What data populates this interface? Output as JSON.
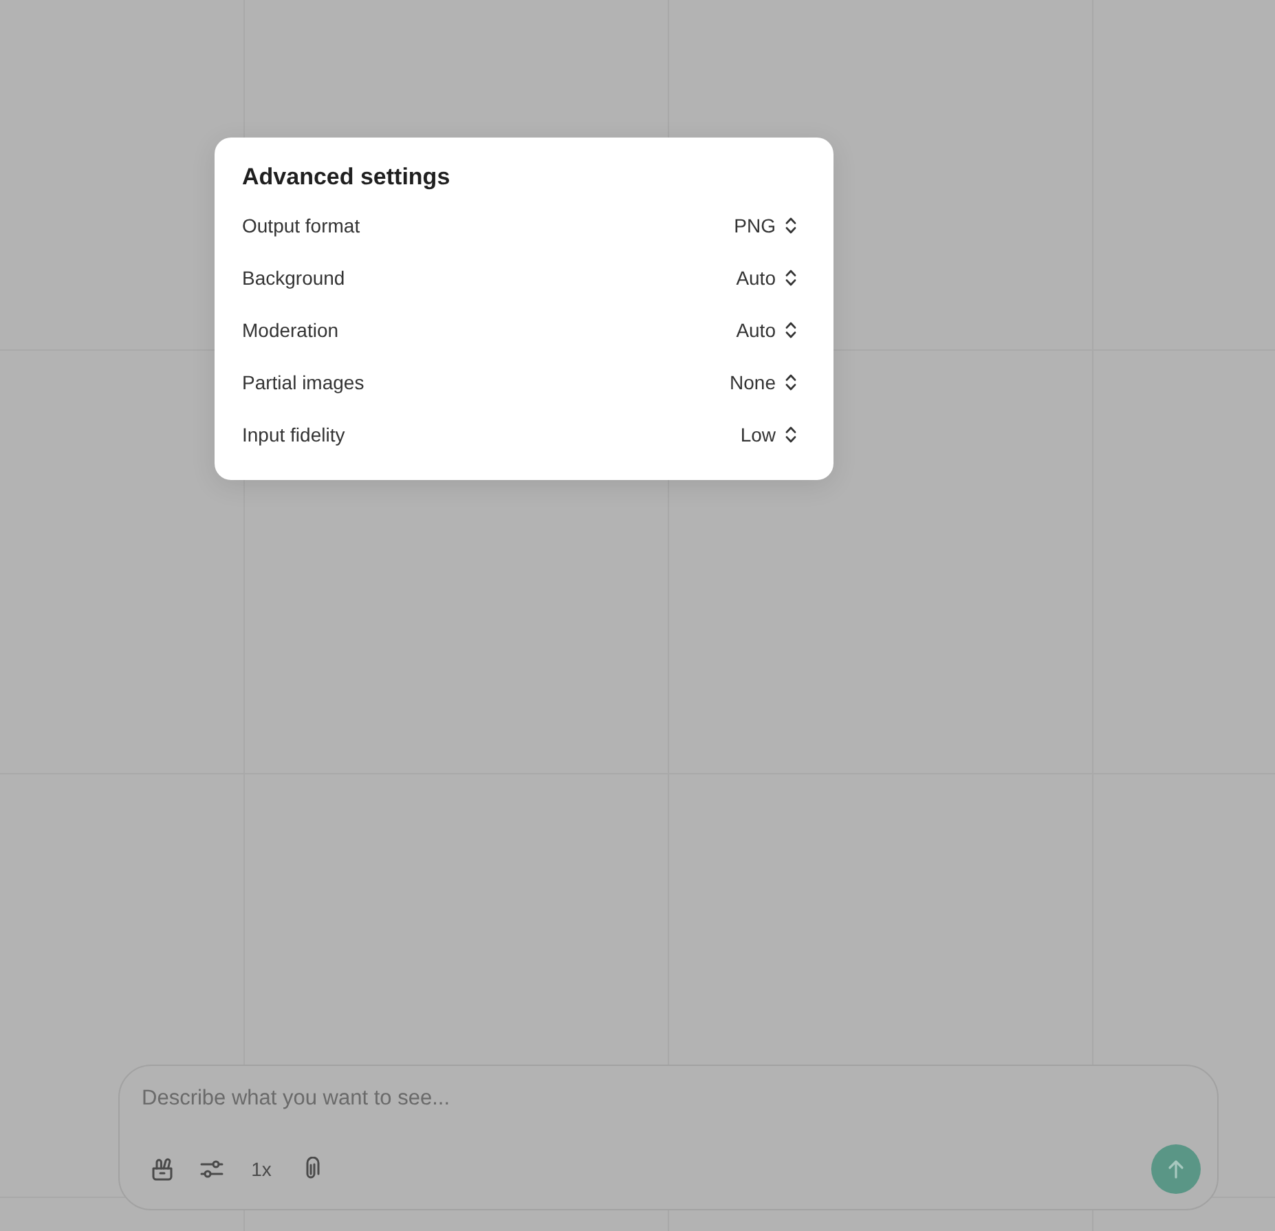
{
  "dialog": {
    "title": "Advanced settings",
    "settings": [
      {
        "label": "Output format",
        "value": "PNG"
      },
      {
        "label": "Background",
        "value": "Auto"
      },
      {
        "label": "Moderation",
        "value": "Auto"
      },
      {
        "label": "Partial images",
        "value": "None"
      },
      {
        "label": "Input fidelity",
        "value": "Low"
      }
    ]
  },
  "composer": {
    "placeholder": "Describe what you want to see...",
    "count": "1x"
  }
}
